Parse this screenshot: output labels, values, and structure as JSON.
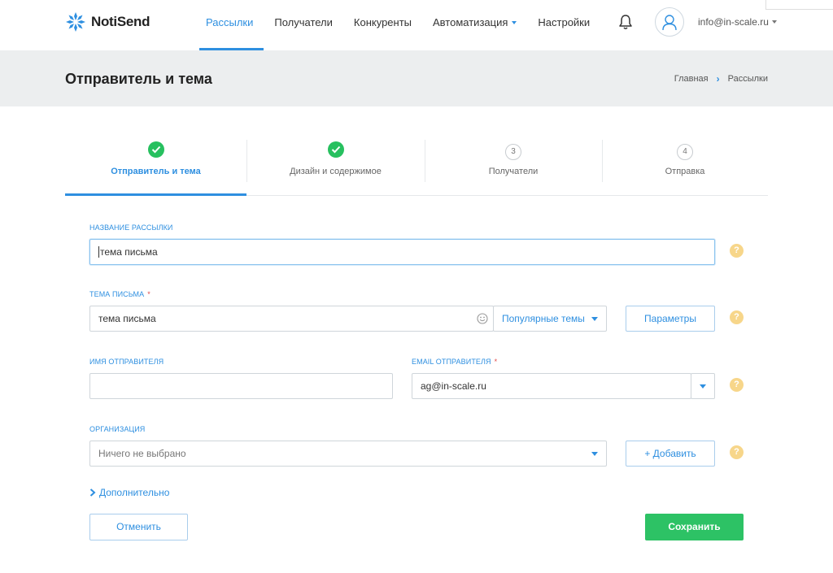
{
  "brand": {
    "name": "NotiSend"
  },
  "nav": [
    {
      "label": "Рассылки",
      "active": true
    },
    {
      "label": "Получатели"
    },
    {
      "label": "Конкуренты"
    },
    {
      "label": "Автоматизация",
      "has_dropdown": true
    },
    {
      "label": "Настройки"
    }
  ],
  "account": {
    "email": "info@in-scale.ru"
  },
  "page": {
    "title": "Отправитель и тема",
    "breadcrumb": [
      "Главная",
      "Рассылки"
    ]
  },
  "steps": [
    {
      "label": "Отправитель и тема",
      "state": "done",
      "active": true
    },
    {
      "label": "Дизайн и содержимое",
      "state": "done"
    },
    {
      "label": "Получатели",
      "number": "3"
    },
    {
      "label": "Отправка",
      "number": "4"
    }
  ],
  "form": {
    "campaign_name": {
      "label": "НАЗВАНИЕ РАССЫЛКИ",
      "value": "тема письма"
    },
    "subject": {
      "label": "ТЕМА ПИСЬМА",
      "required_mark": "*",
      "value": "тема письма",
      "popular_label": "Популярные темы",
      "params_button": "Параметры"
    },
    "sender_name": {
      "label": "ИМЯ ОТПРАВИТЕЛЯ",
      "value": ""
    },
    "sender_email": {
      "label": "EMAIL ОТПРАВИТЕЛЯ",
      "required_mark": "*",
      "value": "ag@in-scale.ru"
    },
    "organization": {
      "label": "ОРГАНИЗАЦИЯ",
      "value": "Ничего не выбрано",
      "add_button": "+ Добавить"
    },
    "help_glyph": "?",
    "more_link": "Дополнительно",
    "cancel_button": "Отменить",
    "save_button": "Сохранить"
  },
  "colors": {
    "accent": "#2e8fe0",
    "success": "#2dc265",
    "help": "#f7d68a",
    "band": "#eceeef"
  }
}
